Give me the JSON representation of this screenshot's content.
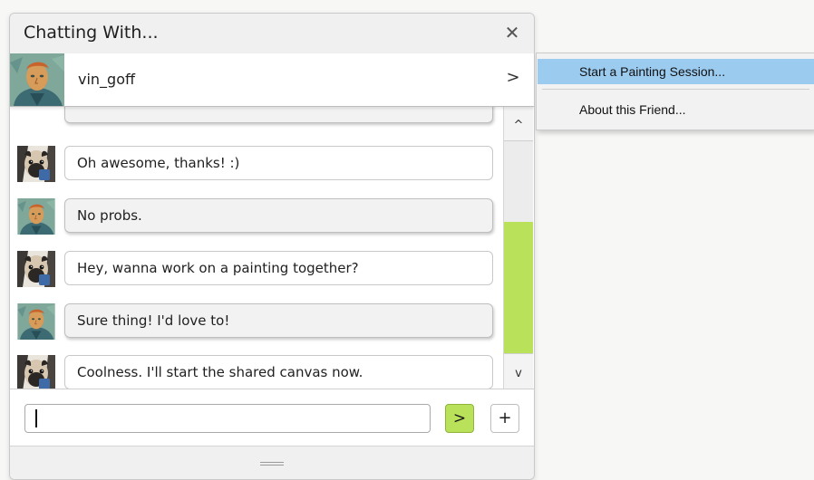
{
  "window": {
    "title": "Chatting With...",
    "close_icon": "close-icon"
  },
  "friend": {
    "name": "vin_goff",
    "avatar": "vincent-portrait-avatar",
    "menu_arrow": ">"
  },
  "messages": [
    {
      "sender": "friend",
      "avatar": "vincent-portrait-avatar",
      "text": ""
    },
    {
      "sender": "self",
      "avatar": "pug-avatar",
      "text": "Oh awesome, thanks! :)"
    },
    {
      "sender": "friend",
      "avatar": "vincent-portrait-avatar",
      "text": "No probs."
    },
    {
      "sender": "self",
      "avatar": "pug-avatar",
      "text": "Hey, wanna work on a painting together?"
    },
    {
      "sender": "friend",
      "avatar": "vincent-portrait-avatar",
      "text": "Sure thing! I'd love to!"
    },
    {
      "sender": "self",
      "avatar": "pug-avatar",
      "text": "Coolness.  I'll start the shared canvas now."
    }
  ],
  "scrollbar": {
    "up_label": "^",
    "down_label": "v",
    "thumb_start": 0.38,
    "thumb_end": 1.0,
    "thumb_color": "#b9e15a"
  },
  "composer": {
    "input_value": "",
    "send_label": ">",
    "add_label": "+"
  },
  "context_menu": {
    "items": [
      {
        "label": "Start a Painting Session...",
        "highlighted": true
      },
      {
        "label": "About this Friend...",
        "highlighted": false
      }
    ],
    "highlight_color": "#9ccbf0"
  },
  "colors": {
    "accent_green": "#b9e15a"
  }
}
